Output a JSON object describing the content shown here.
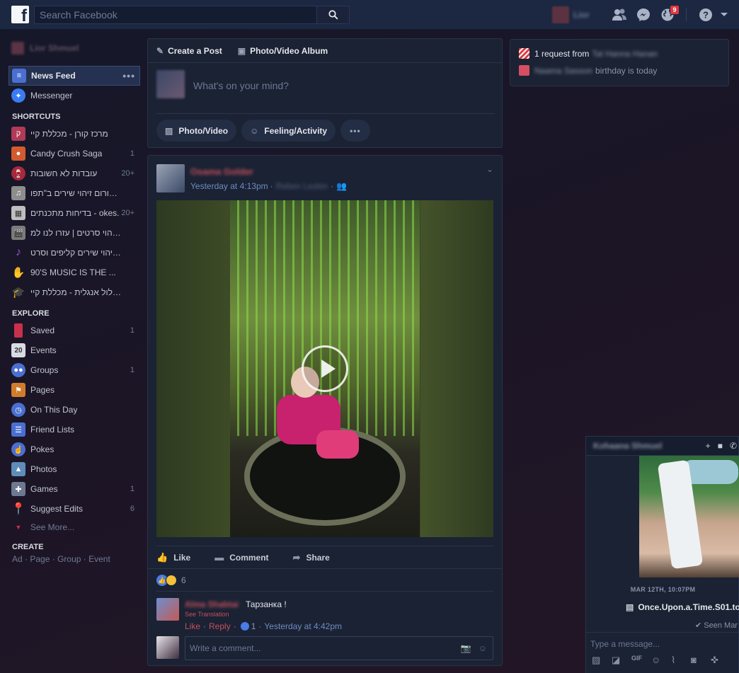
{
  "topbar": {
    "logo": "f",
    "search_placeholder": "Search Facebook",
    "user_name": "Lior",
    "notifications_count": "9"
  },
  "leftnav": {
    "profile_name": "Lior Shmuel",
    "main": [
      {
        "label": "News Feed",
        "icon": "news-feed-icon",
        "color": "#4a6fd1"
      },
      {
        "label": "Messenger",
        "icon": "messenger-icon",
        "color": "#3b7bf2"
      }
    ],
    "shortcuts_title": "SHORTCUTS",
    "shortcuts": [
      {
        "label": "מרכז קורן - מכללת קיי",
        "count": "",
        "color": "#b03a57"
      },
      {
        "label": "Candy Crush Saga",
        "count": "1",
        "color": "#d35a2f"
      },
      {
        "label": "עובדות לא חשובות",
        "count": "20+",
        "color": "#a8283c"
      },
      {
        "label": "פורום זיהוי שירים ב\"תפו...",
        "count": "",
        "color": "#8d8d8d"
      },
      {
        "label": "בדיחות מתכנתים - okes.",
        "count": "20+",
        "color": "#bfbfbf"
      },
      {
        "label": "זיהוי סרטים | עזרו לנו למ...",
        "count": "",
        "color": "#7b7b7b"
      },
      {
        "label": "זיהוי שירים קליפים וסרט...",
        "count": "",
        "color": "#8e5bd1"
      },
      {
        "label": "90'S MUSIC IS THE ...",
        "count": "",
        "color": "#c9892e"
      },
      {
        "label": "מסלול אנגלית - מכללת קיי",
        "count": "",
        "color": "#3a3a3a"
      }
    ],
    "explore_title": "EXPLORE",
    "explore": [
      {
        "label": "Saved",
        "count": "1",
        "color": "#c9304a"
      },
      {
        "label": "Events",
        "count": "",
        "color": "#9aa3b5"
      },
      {
        "label": "Groups",
        "count": "1",
        "color": "#4a6fd1"
      },
      {
        "label": "Pages",
        "count": "",
        "color": "#d27b2b"
      },
      {
        "label": "On This Day",
        "count": "",
        "color": "#4a6fd1"
      },
      {
        "label": "Friend Lists",
        "count": "",
        "color": "#4a6fd1"
      },
      {
        "label": "Pokes",
        "count": "",
        "color": "#4a6fd1"
      },
      {
        "label": "Photos",
        "count": "",
        "color": "#5f8cb8"
      },
      {
        "label": "Games",
        "count": "1",
        "color": "#6d7893"
      },
      {
        "label": "Suggest Edits",
        "count": "6",
        "color": "#c9304a"
      }
    ],
    "events_day": "20",
    "see_more": "See More...",
    "create_title": "CREATE",
    "create_links": [
      "Ad",
      "Page",
      "Group",
      "Event"
    ]
  },
  "composer": {
    "tab_create_post": "Create a Post",
    "tab_album": "Photo/Video Album",
    "placeholder": "What's on your mind?",
    "btn_photo": "Photo/Video",
    "btn_feeling": "Feeling/Activity"
  },
  "post": {
    "author": "Osama Golder",
    "time": "Yesterday at 4:13pm",
    "with_name": "Reben Lezkin",
    "action_like": "Like",
    "action_comment": "Comment",
    "action_share": "Share",
    "reactions_count": "6",
    "comment": {
      "author": "Alma Shabtai",
      "text": "Тарзанка !",
      "see_translation": "See Translation",
      "like": "Like",
      "reply": "Reply",
      "like_count": "1",
      "time": "Yesterday at 4:42pm"
    },
    "write_placeholder": "Write a comment..."
  },
  "requests": {
    "request_text": "1 request from",
    "request_name": "Tal Hanna Hanan",
    "birthday_name": "Naama Sasson",
    "birthday_text": "birthday is today"
  },
  "chat": {
    "name": "Kohaana Shmuel",
    "date": "MAR 12TH, 10:07PM",
    "file": "Once.Upon.a.Time.S01.to",
    "seen": "Seen Mar",
    "placeholder": "Type a message..."
  }
}
